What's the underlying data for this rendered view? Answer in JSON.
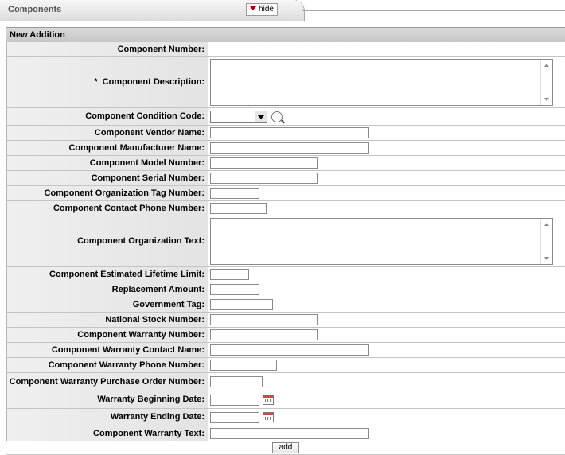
{
  "tab": {
    "title": "Components",
    "hide_label": "hide"
  },
  "section": {
    "title": "New Addition"
  },
  "fields": [
    {
      "label": "Component Number:",
      "kind": "none"
    },
    {
      "label": "Component Description:",
      "required": "*",
      "kind": "textarea"
    },
    {
      "label": "Component Condition Code:",
      "kind": "select",
      "value": ""
    },
    {
      "label": "Component Vendor Name:",
      "kind": "text",
      "value": ""
    },
    {
      "label": "Component Manufacturer Name:",
      "kind": "text",
      "value": ""
    },
    {
      "label": "Component Model Number:",
      "kind": "text",
      "value": ""
    },
    {
      "label": "Component Serial Number:",
      "kind": "text",
      "value": ""
    },
    {
      "label": "Component Organization Tag Number:",
      "kind": "text",
      "value": ""
    },
    {
      "label": "Component Contact Phone Number:",
      "kind": "text",
      "value": ""
    },
    {
      "label": "Component Organization Text:",
      "kind": "textarea"
    },
    {
      "label": "Component Estimated Lifetime Limit:",
      "kind": "text",
      "value": ""
    },
    {
      "label": "Replacement Amount:",
      "kind": "text",
      "value": ""
    },
    {
      "label": "Government Tag:",
      "kind": "text",
      "value": ""
    },
    {
      "label": "National Stock Number:",
      "kind": "text",
      "value": ""
    },
    {
      "label": "Component Warranty Number:",
      "kind": "text",
      "value": ""
    },
    {
      "label": "Component Warranty Contact Name:",
      "kind": "text",
      "value": ""
    },
    {
      "label": "Component Warranty Phone Number:",
      "kind": "text",
      "value": ""
    },
    {
      "label": "Component Warranty Purchase Order Number:",
      "kind": "text",
      "value": ""
    },
    {
      "label": "Warranty Beginning Date:",
      "kind": "date",
      "value": ""
    },
    {
      "label": "Warranty Ending Date:",
      "kind": "date",
      "value": ""
    },
    {
      "label": "Component Warranty Text:",
      "kind": "text",
      "value": ""
    }
  ],
  "add_label": "add",
  "icons": {
    "lookup": "magnifier-icon",
    "calendar": "calendar-icon",
    "collapse": "triangle-down-icon"
  }
}
